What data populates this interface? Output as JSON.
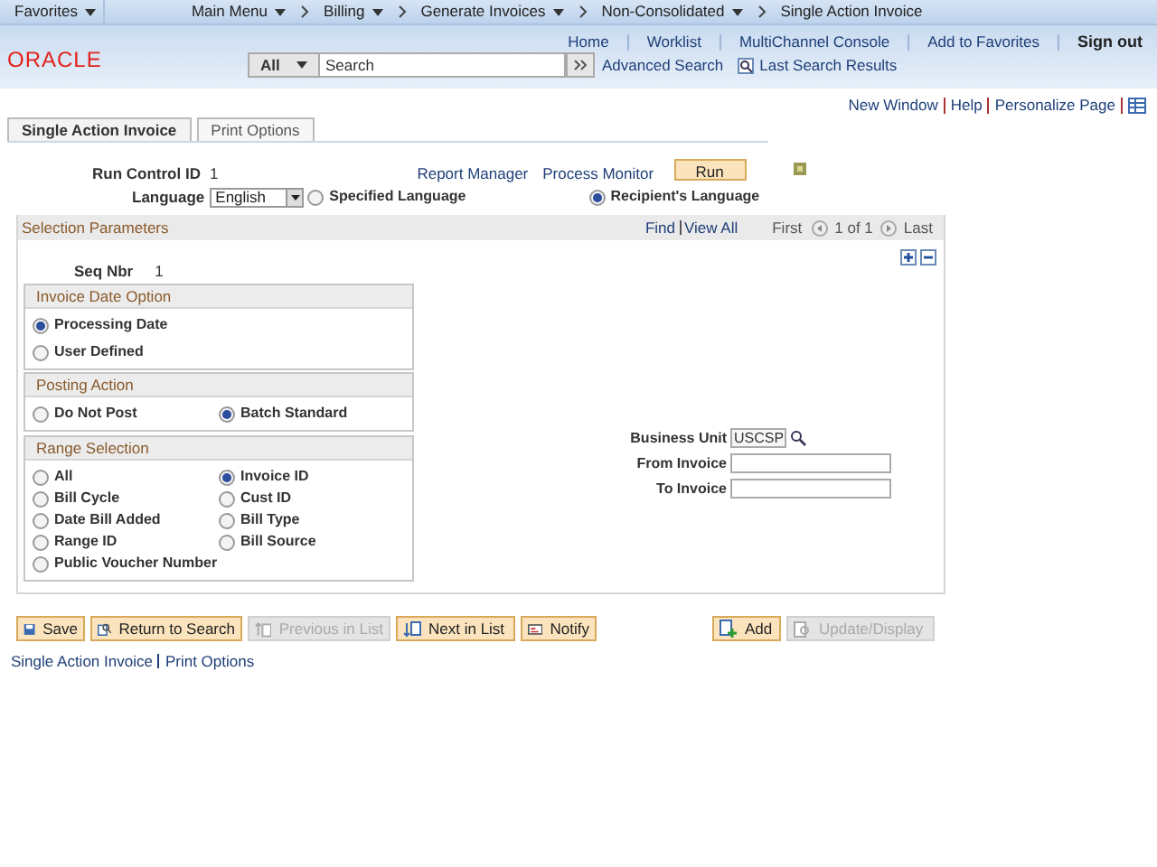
{
  "breadcrumbs": [
    {
      "label": "Favorites",
      "dropdown": true
    },
    {
      "label": "Main Menu",
      "dropdown": true
    },
    {
      "label": "Billing",
      "dropdown": true
    },
    {
      "label": "Generate Invoices",
      "dropdown": true
    },
    {
      "label": "Non-Consolidated",
      "dropdown": true
    },
    {
      "label": "Single Action Invoice",
      "dropdown": false
    }
  ],
  "header_links": [
    {
      "label": "Home",
      "bold": false
    },
    {
      "label": "Worklist",
      "bold": false
    },
    {
      "label": "MultiChannel Console",
      "bold": false
    },
    {
      "label": "Add to Favorites",
      "bold": false
    },
    {
      "label": "Sign out",
      "bold": true
    }
  ],
  "logo": "ORACLE",
  "search": {
    "scope": "All",
    "placeholder": "Search",
    "advanced": "Advanced Search",
    "last_results": "Last Search Results"
  },
  "page_links": [
    "New Window",
    "Help",
    "Personalize Page"
  ],
  "tabs": [
    {
      "label": "Single Action Invoice",
      "selected": true
    },
    {
      "label": "Print Options",
      "selected": false
    }
  ],
  "run_control": {
    "label": "Run Control ID",
    "value": "1"
  },
  "process_links": [
    "Report Manager",
    "Process Monitor"
  ],
  "run_button": "Run",
  "language": {
    "label": "Language",
    "value": "English",
    "options": [
      {
        "label": "Specified Language",
        "selected": false
      },
      {
        "label": "Recipient's Language",
        "selected": true
      }
    ]
  },
  "selection": {
    "title": "Selection Parameters",
    "find": "Find",
    "view_all": "View All",
    "first": "First",
    "counter": "1 of 1",
    "last": "Last",
    "seq_label": "Seq Nbr",
    "seq_value": "1",
    "invoice_date_option": {
      "title": "Invoice Date Option",
      "options": [
        {
          "label": "Processing Date",
          "selected": true
        },
        {
          "label": "User Defined",
          "selected": false
        }
      ]
    },
    "posting_action": {
      "title": "Posting Action",
      "options": [
        {
          "label": "Do Not Post",
          "selected": false
        },
        {
          "label": "Batch Standard",
          "selected": true
        }
      ]
    },
    "range_selection": {
      "title": "Range Selection",
      "options": [
        {
          "label": "All",
          "selected": false
        },
        {
          "label": "Invoice ID",
          "selected": true
        },
        {
          "label": "Bill Cycle",
          "selected": false
        },
        {
          "label": "Cust ID",
          "selected": false
        },
        {
          "label": "Date Bill Added",
          "selected": false
        },
        {
          "label": "Bill Type",
          "selected": false
        },
        {
          "label": "Range ID",
          "selected": false
        },
        {
          "label": "Bill Source",
          "selected": false
        },
        {
          "label": "Public Voucher Number",
          "selected": false
        }
      ]
    },
    "fields": [
      {
        "label": "Business Unit",
        "value": "USCSP",
        "kind": "lookup"
      },
      {
        "label": "From Invoice",
        "kind": "text"
      },
      {
        "label": "To Invoice",
        "kind": "text"
      }
    ]
  },
  "toolbar": [
    {
      "label": "Save",
      "kind": "save",
      "disabled": false
    },
    {
      "label": "Return to Search",
      "kind": "return",
      "disabled": false
    },
    {
      "label": "Previous in List",
      "kind": "prev",
      "disabled": true
    },
    {
      "label": "Next in List",
      "kind": "next",
      "disabled": false
    },
    {
      "label": "Notify",
      "kind": "notify",
      "disabled": false
    },
    {
      "label": "Add",
      "kind": "add",
      "disabled": false
    },
    {
      "label": "Update/Display",
      "kind": "update",
      "disabled": true
    }
  ],
  "footer_links": [
    "Single Action Invoice",
    "Print Options"
  ]
}
